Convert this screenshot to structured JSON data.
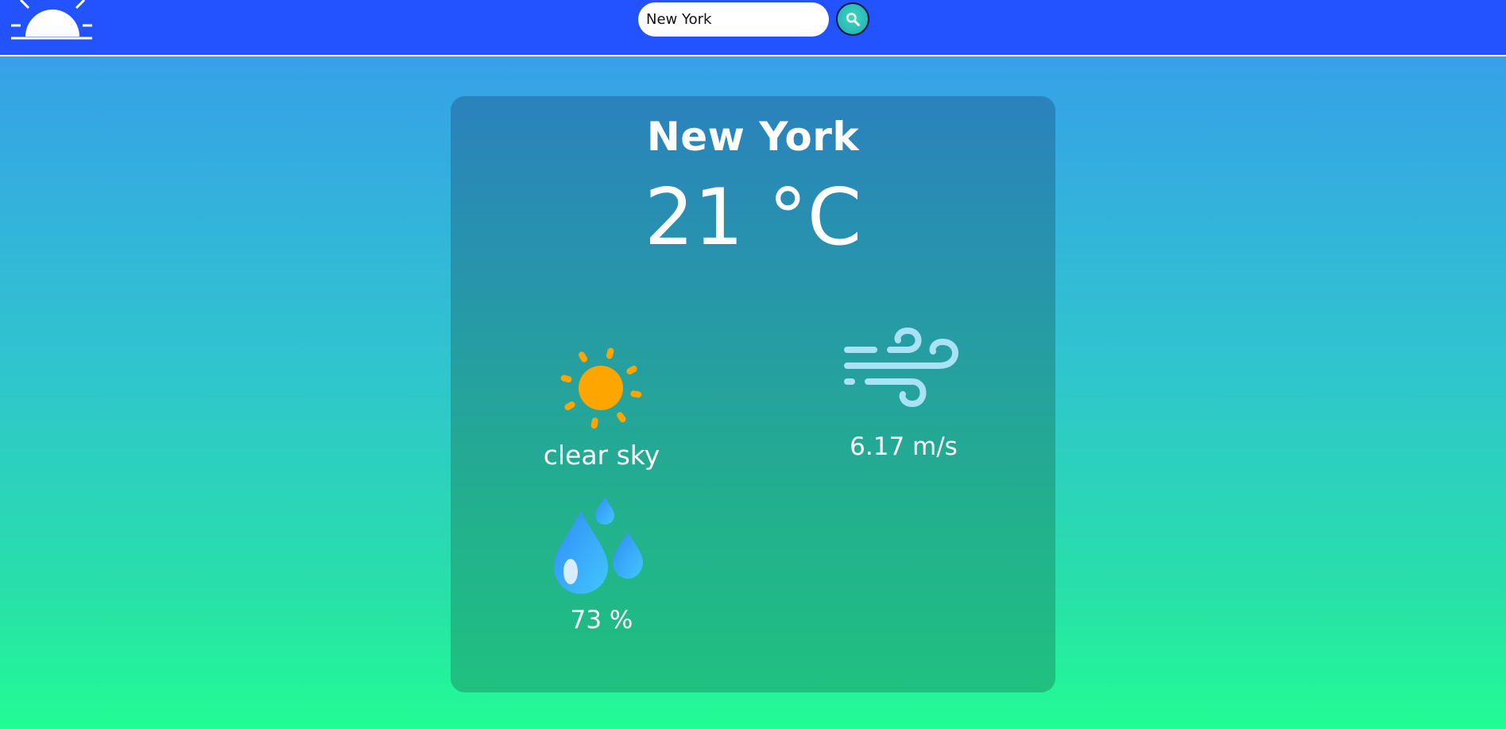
{
  "header": {
    "logo_icon": "sunrise-icon",
    "search": {
      "value": "New York",
      "placeholder": ""
    },
    "search_button_icon": "search-icon"
  },
  "weather": {
    "city": "New York",
    "temperature": "21 °C",
    "condition_icon": "sun-icon",
    "description": "clear sky",
    "wind_icon": "wind-icon",
    "wind_speed": "6.17 m/s",
    "humidity_icon": "water-drops-icon",
    "humidity": "73 %"
  },
  "colors": {
    "header_bg": "#2353ff",
    "bg_top": "#36a0e8",
    "bg_bottom": "#22fc94",
    "sun": "#ffa500",
    "wind": "#a9e2f5",
    "drop": "#3a9dff"
  }
}
